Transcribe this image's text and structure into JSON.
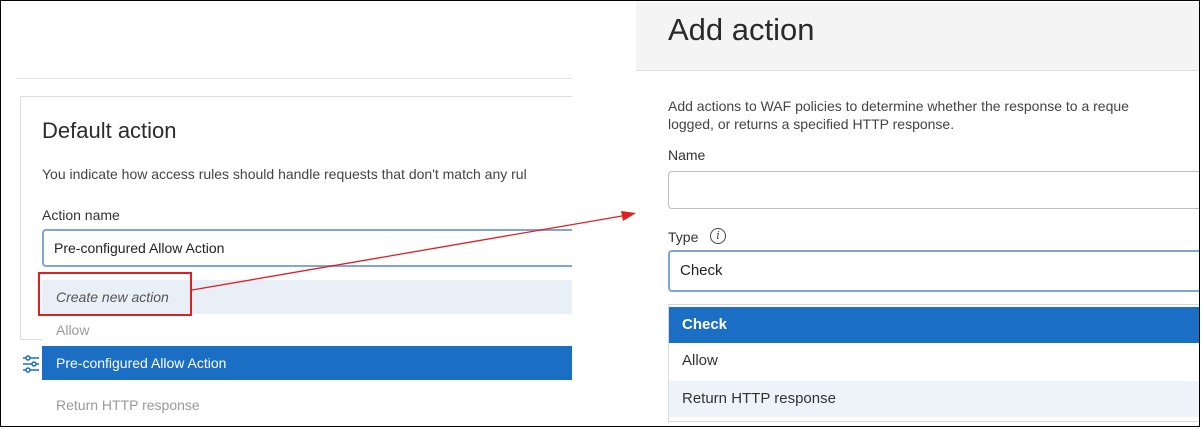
{
  "left_panel": {
    "title": "Default action",
    "description": "You indicate how access rules should handle requests that don't match any rul",
    "action_name_label": "Action name",
    "action_name_value": "Pre-configured Allow Action",
    "dropdown": {
      "create_option": "Create new action",
      "options": [
        "Allow",
        "Pre-configured Allow Action",
        "Return HTTP response"
      ],
      "selected": "Pre-configured Allow Action"
    }
  },
  "right_panel": {
    "title": "Add action",
    "description": "Add actions to WAF policies to determine whether the response to a reque\nlogged, or returns a specified HTTP response.",
    "name_label": "Name",
    "name_value": "",
    "type_label": "Type",
    "type_value": "Check",
    "info_icon": "i",
    "dropdown": {
      "options": [
        "Check",
        "Allow",
        "Return HTTP response"
      ],
      "selected": "Check"
    }
  },
  "annotation": {
    "highlight_color": "#e02020",
    "arrow_color": "#e02020"
  },
  "colors": {
    "selected_bg": "#1a6fc4",
    "focus_border": "#7fa6da"
  }
}
